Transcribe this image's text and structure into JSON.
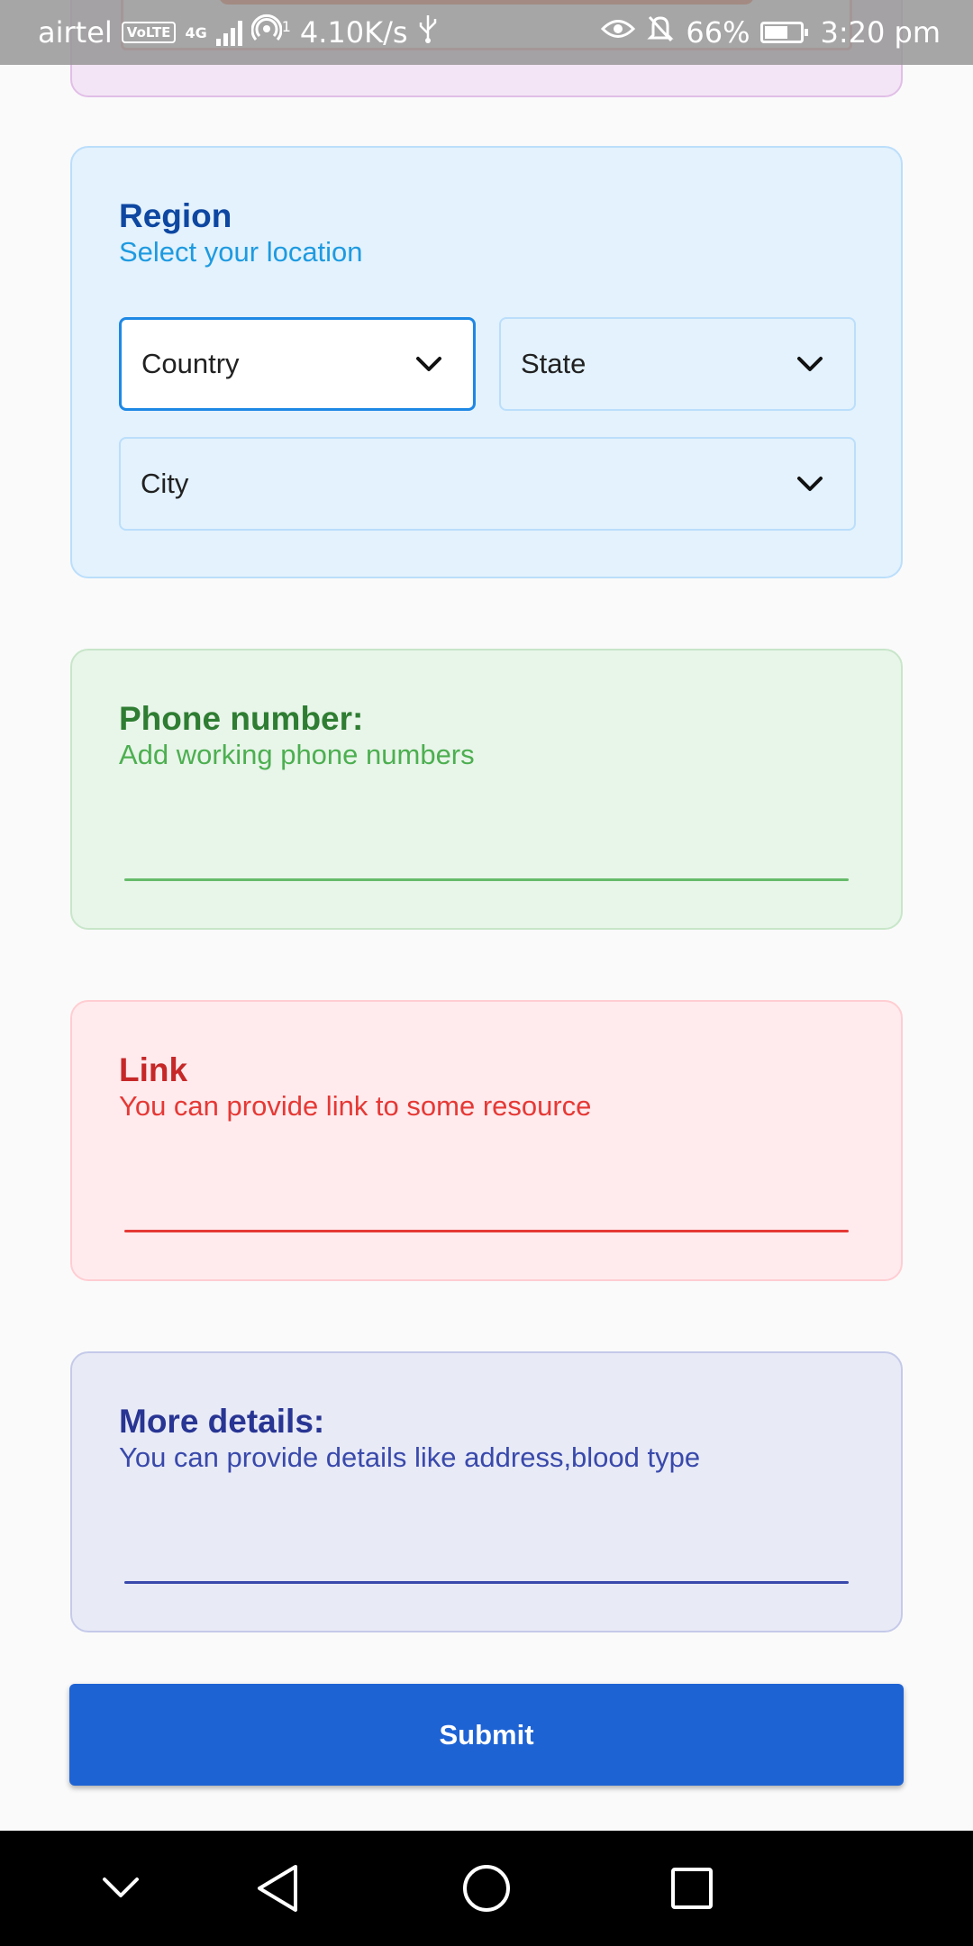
{
  "status_bar": {
    "carrier": "airtel",
    "volte": "VoLTE",
    "network": "4G",
    "hotspot_sup": "1",
    "speed": "4.10K/s",
    "battery": "66%",
    "battery_level": 0.66,
    "time": "3:20 pm"
  },
  "region": {
    "title": "Region",
    "subtitle": "Select your location",
    "country_label": "Country",
    "state_label": "State",
    "city_label": "City"
  },
  "phone": {
    "title": "Phone number:",
    "subtitle": "Add working phone numbers"
  },
  "link": {
    "title": "Link",
    "subtitle": "You can provide link to some resource"
  },
  "details": {
    "title": "More details:",
    "subtitle": "You can provide details like address,blood type"
  },
  "submit_label": "Submit",
  "colors": {
    "region_accent": "#0d47a1",
    "phone_accent": "#2e7d32",
    "link_accent": "#c62828",
    "details_accent": "#283593",
    "submit": "#1e63d4"
  },
  "icons": {
    "dropdown": "chevron-down-icon",
    "nav": [
      "chevron-down-icon",
      "back-icon",
      "home-icon",
      "recents-icon"
    ]
  }
}
